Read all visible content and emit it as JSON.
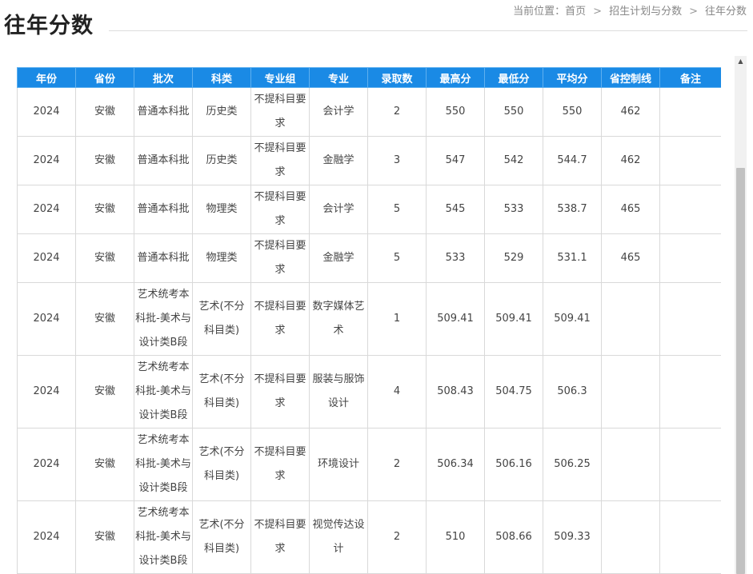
{
  "page": {
    "title": "往年分数"
  },
  "breadcrumb": {
    "prefix": "当前位置：",
    "items": [
      "首页",
      "招生计划与分数",
      "往年分数"
    ],
    "separator": ">"
  },
  "table": {
    "headers": [
      "年份",
      "省份",
      "批次",
      "科类",
      "专业组",
      "专业",
      "录取数",
      "最高分",
      "最低分",
      "平均分",
      "省控制线",
      "备注"
    ],
    "rows": [
      [
        "2024",
        "安徽",
        "普通本科批",
        "历史类",
        "不提科目要求",
        "会计学",
        "2",
        "550",
        "550",
        "550",
        "462",
        ""
      ],
      [
        "2024",
        "安徽",
        "普通本科批",
        "历史类",
        "不提科目要求",
        "金融学",
        "3",
        "547",
        "542",
        "544.7",
        "462",
        ""
      ],
      [
        "2024",
        "安徽",
        "普通本科批",
        "物理类",
        "不提科目要求",
        "会计学",
        "5",
        "545",
        "533",
        "538.7",
        "465",
        ""
      ],
      [
        "2024",
        "安徽",
        "普通本科批",
        "物理类",
        "不提科目要求",
        "金融学",
        "5",
        "533",
        "529",
        "531.1",
        "465",
        ""
      ],
      [
        "2024",
        "安徽",
        "艺术统考本科批-美术与设计类B段",
        "艺术(不分科目类)",
        "不提科目要求",
        "数字媒体艺术",
        "1",
        "509.41",
        "509.41",
        "509.41",
        "",
        ""
      ],
      [
        "2024",
        "安徽",
        "艺术统考本科批-美术与设计类B段",
        "艺术(不分科目类)",
        "不提科目要求",
        "服装与服饰设计",
        "4",
        "508.43",
        "504.75",
        "506.3",
        "",
        ""
      ],
      [
        "2024",
        "安徽",
        "艺术统考本科批-美术与设计类B段",
        "艺术(不分科目类)",
        "不提科目要求",
        "环境设计",
        "2",
        "506.34",
        "506.16",
        "506.25",
        "",
        ""
      ],
      [
        "2024",
        "安徽",
        "艺术统考本科批-美术与设计类B段",
        "艺术(不分科目类)",
        "不提科目要求",
        "视觉传达设计",
        "2",
        "510",
        "508.66",
        "509.33",
        "",
        ""
      ]
    ]
  },
  "scrollbar": {
    "up_icon": "arrow-up-icon"
  }
}
